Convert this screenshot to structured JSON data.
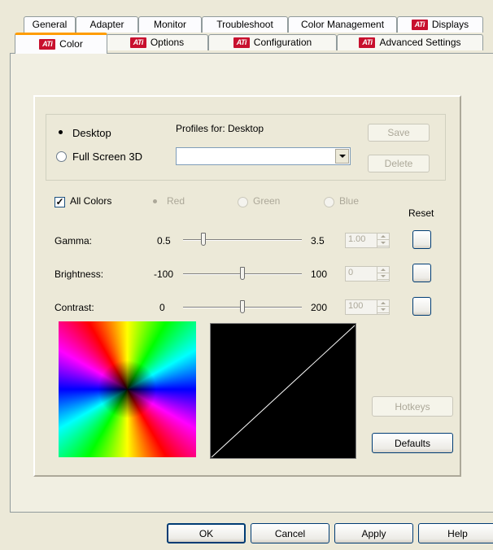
{
  "tabs_row1": [
    {
      "label": "General",
      "ati": false
    },
    {
      "label": "Adapter",
      "ati": false
    },
    {
      "label": "Monitor",
      "ati": false
    },
    {
      "label": "Troubleshoot",
      "ati": false
    },
    {
      "label": "Color Management",
      "ati": false
    },
    {
      "label": "Displays",
      "ati": true
    }
  ],
  "tabs_row2": [
    {
      "label": "Color",
      "ati": true,
      "selected": true
    },
    {
      "label": "Options",
      "ati": true
    },
    {
      "label": "Configuration",
      "ati": true
    },
    {
      "label": "Advanced Settings",
      "ati": true
    }
  ],
  "ati_logo_text": "ATi",
  "mode": {
    "desktop_label": "Desktop",
    "fullscreen_label": "Full Screen 3D",
    "selected": "Desktop"
  },
  "profiles": {
    "label": "Profiles for: Desktop",
    "value": "",
    "save_label": "Save",
    "delete_label": "Delete"
  },
  "channels": {
    "all_colors_label": "All Colors",
    "all_colors_checked": true,
    "red_label": "Red",
    "green_label": "Green",
    "blue_label": "Blue",
    "reset_label": "Reset"
  },
  "sliders": [
    {
      "label": "Gamma:",
      "min": "0.5",
      "max": "3.5",
      "value": "1.00",
      "fraction": 0.17
    },
    {
      "label": "Brightness:",
      "min": "-100",
      "max": "100",
      "value": "0",
      "fraction": 0.5
    },
    {
      "label": "Contrast:",
      "min": "0",
      "max": "200",
      "value": "100",
      "fraction": 0.5
    }
  ],
  "buttons": {
    "hotkeys": "Hotkeys",
    "defaults": "Defaults",
    "ok": "OK",
    "cancel": "Cancel",
    "apply": "Apply",
    "help": "Help"
  }
}
